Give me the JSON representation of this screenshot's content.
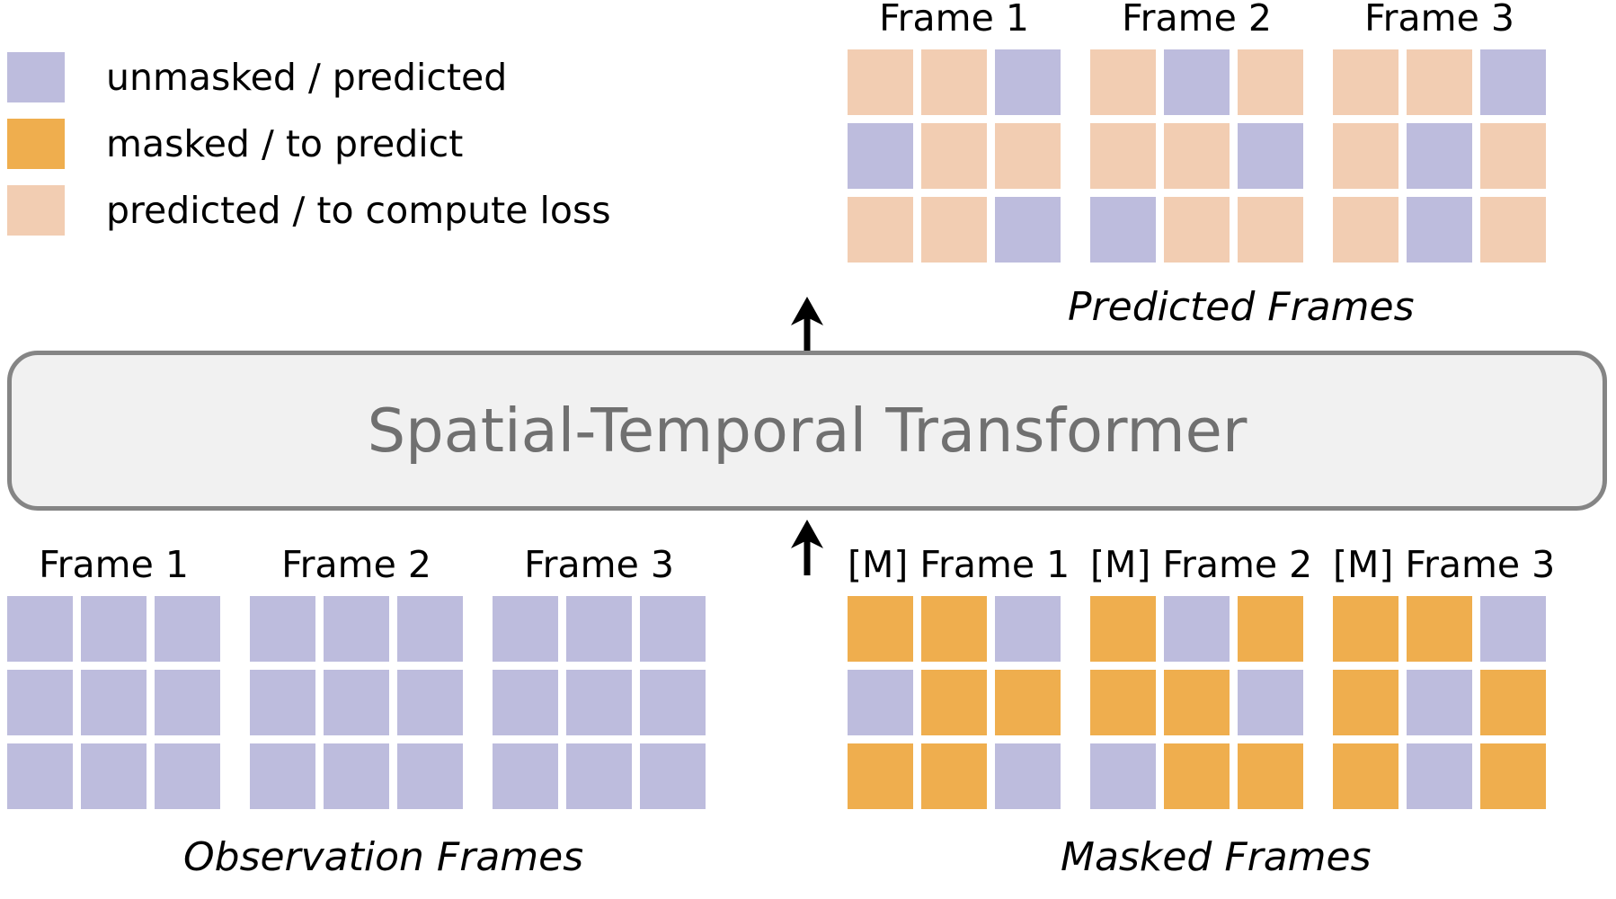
{
  "colors": {
    "unmasked": "#bdbcdd",
    "masked": "#efae4e",
    "predicted": "#f2cdb2",
    "box_fill": "#f1f1f1",
    "box_border": "#858585",
    "box_text": "#707070",
    "text": "#000000",
    "background": "#ffffff"
  },
  "legend": {
    "items": [
      {
        "swatch": "unmasked",
        "label": "unmasked / predicted"
      },
      {
        "swatch": "masked",
        "label": "masked / to predict"
      },
      {
        "swatch": "predicted",
        "label": "predicted / to compute loss"
      }
    ]
  },
  "transformer": {
    "label": "Spatial-Temporal Transformer"
  },
  "arrows": {
    "input_arrow": "arrow-up",
    "output_arrow": "arrow-up"
  },
  "captions": {
    "predicted": "Predicted Frames",
    "observation": "Observation Frames",
    "masked": "Masked Frames"
  },
  "predicted_frames": {
    "caption": "Predicted Frames",
    "frames": [
      {
        "title": "Frame 1",
        "cells": [
          "predicted",
          "predicted",
          "unmasked",
          "unmasked",
          "predicted",
          "predicted",
          "predicted",
          "predicted",
          "unmasked"
        ]
      },
      {
        "title": "Frame 2",
        "cells": [
          "predicted",
          "unmasked",
          "predicted",
          "predicted",
          "predicted",
          "unmasked",
          "unmasked",
          "predicted",
          "predicted"
        ]
      },
      {
        "title": "Frame 3",
        "cells": [
          "predicted",
          "predicted",
          "unmasked",
          "predicted",
          "unmasked",
          "predicted",
          "predicted",
          "unmasked",
          "predicted"
        ]
      }
    ]
  },
  "observation_frames": {
    "caption": "Observation Frames",
    "frames": [
      {
        "title": "Frame 1",
        "cells": [
          "unmasked",
          "unmasked",
          "unmasked",
          "unmasked",
          "unmasked",
          "unmasked",
          "unmasked",
          "unmasked",
          "unmasked"
        ]
      },
      {
        "title": "Frame 2",
        "cells": [
          "unmasked",
          "unmasked",
          "unmasked",
          "unmasked",
          "unmasked",
          "unmasked",
          "unmasked",
          "unmasked",
          "unmasked"
        ]
      },
      {
        "title": "Frame 3",
        "cells": [
          "unmasked",
          "unmasked",
          "unmasked",
          "unmasked",
          "unmasked",
          "unmasked",
          "unmasked",
          "unmasked",
          "unmasked"
        ]
      }
    ]
  },
  "masked_frames": {
    "caption": "Masked Frames",
    "frames": [
      {
        "title": "[M] Frame 1",
        "cells": [
          "masked",
          "masked",
          "unmasked",
          "unmasked",
          "masked",
          "masked",
          "masked",
          "masked",
          "unmasked"
        ]
      },
      {
        "title": "[M] Frame 2",
        "cells": [
          "masked",
          "unmasked",
          "masked",
          "masked",
          "masked",
          "unmasked",
          "unmasked",
          "masked",
          "masked"
        ]
      },
      {
        "title": "[M] Frame 3",
        "cells": [
          "masked",
          "masked",
          "unmasked",
          "masked",
          "unmasked",
          "masked",
          "masked",
          "unmasked",
          "masked"
        ]
      }
    ]
  }
}
